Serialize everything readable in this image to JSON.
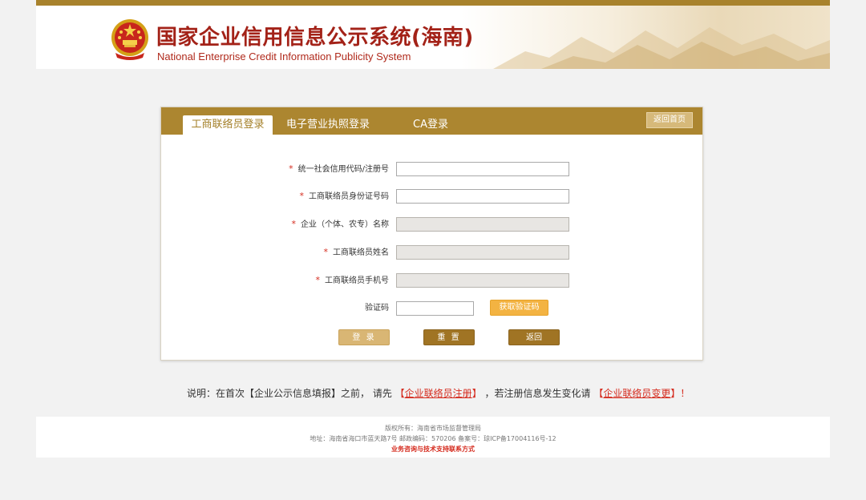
{
  "header": {
    "title_cn": "国家企业信用信息公示系统(海南)",
    "title_en": "National Enterprise Credit Information Publicity System"
  },
  "tabs": [
    {
      "label": "工商联络员登录",
      "active": true
    },
    {
      "label": "电子营业执照登录",
      "active": false
    },
    {
      "label": "CA登录",
      "active": false
    }
  ],
  "back_home_label": "返回首页",
  "form": {
    "required_mark": "*",
    "fields": [
      {
        "label": "统一社会信用代码/注册号",
        "value": "",
        "disabled": false
      },
      {
        "label": "工商联络员身份证号码",
        "value": "",
        "disabled": false
      },
      {
        "label": "企业（个体、农专）名称",
        "value": "",
        "disabled": true
      },
      {
        "label": "工商联络员姓名",
        "value": "",
        "disabled": true
      },
      {
        "label": "工商联络员手机号",
        "value": "",
        "disabled": true
      }
    ],
    "captcha_label": "验证码",
    "captcha_value": "",
    "get_code_label": "获取验证码",
    "login_label": "登 录",
    "reset_label": "重 置",
    "back_label": "返回"
  },
  "note": {
    "prefix": "说明：在首次【企业公示信息填报】之前， 请先",
    "link1_open": "【",
    "link1": "企业联络员注册",
    "link1_close": "】",
    "middle": "，若注册信息发生变化请",
    "link2_open": "【",
    "link2": "企业联络员变更",
    "link2_close": "】！"
  },
  "footer": {
    "copyright": "版权所有：海南省市场监督管理局",
    "address": "地址：海南省海口市蓝天路7号 邮政编码：570206 备案号：琼ICP备17004116号-12",
    "contact": "业务咨询与技术支持联系方式"
  },
  "colors": {
    "brand_gold": "#ac8630",
    "title_red": "#a32218",
    "required_red": "#d52b1e",
    "get_code_orange": "#f3b342"
  }
}
